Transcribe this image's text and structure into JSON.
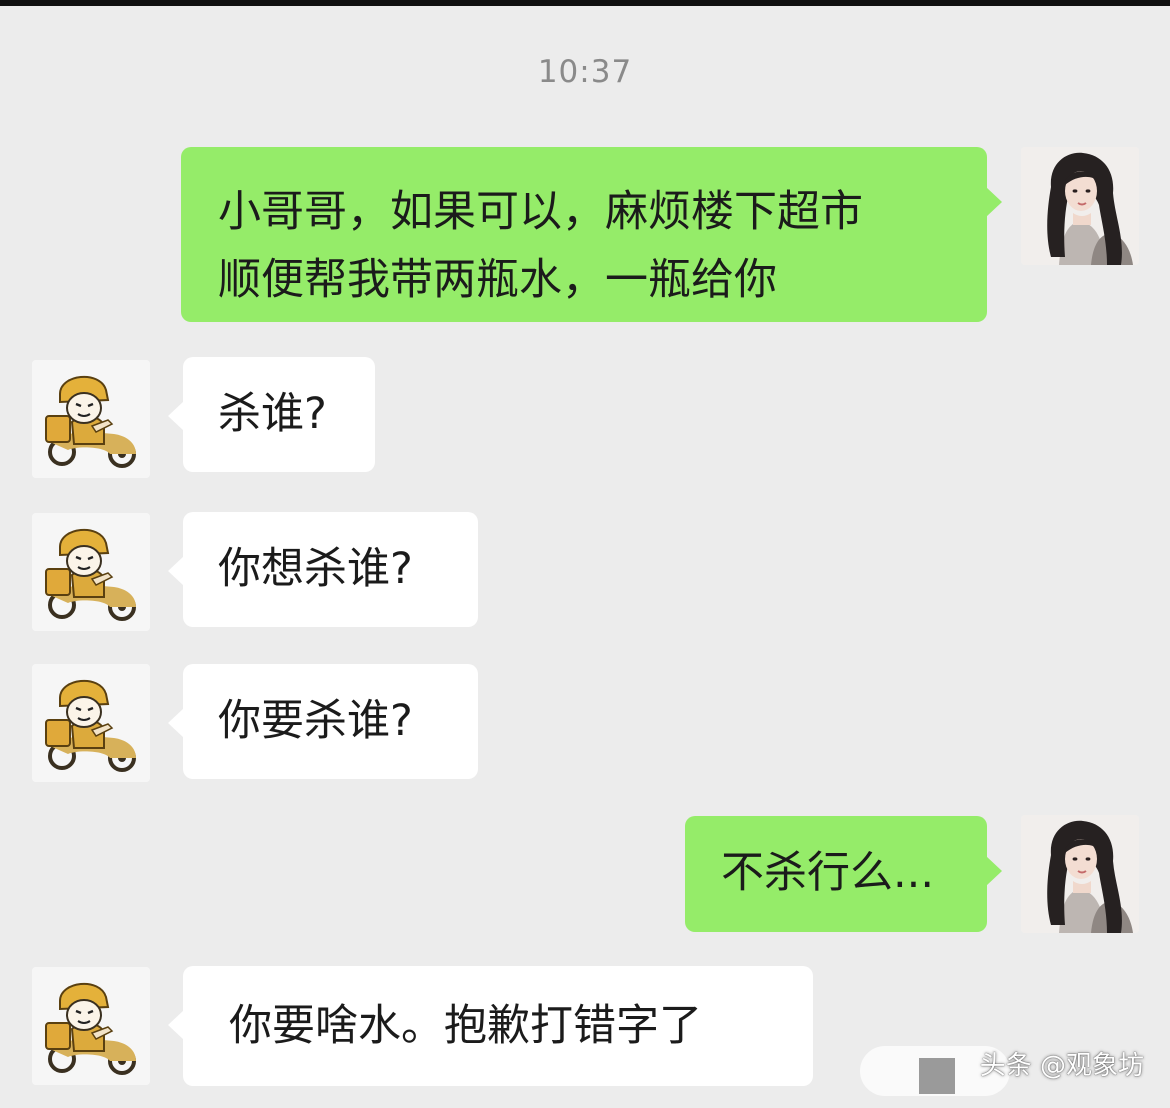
{
  "chat": {
    "timestamp": "10:37",
    "messages": [
      {
        "sender": "self",
        "lines": [
          "小哥哥，如果可以，麻烦楼下超市",
          "顺便帮我带两瓶水，一瓶给你"
        ]
      },
      {
        "sender": "courier",
        "lines": [
          "杀谁?"
        ]
      },
      {
        "sender": "courier",
        "lines": [
          "你想杀谁?"
        ]
      },
      {
        "sender": "courier",
        "lines": [
          "你要杀谁?"
        ]
      },
      {
        "sender": "self",
        "lines": [
          "不杀行么..."
        ]
      },
      {
        "sender": "courier",
        "lines": [
          "你要啥水。抱歉打错字了"
        ]
      }
    ]
  },
  "avatars": {
    "self": "girl-portrait-avatar",
    "courier": "courier-scooter-meme-avatar"
  },
  "watermark": "头条 @观象坊",
  "colors": {
    "background": "#ececec",
    "outgoing_bubble": "#95ec69",
    "incoming_bubble": "#ffffff",
    "timestamp": "#8a8a8a",
    "text": "#1b1b1b"
  }
}
